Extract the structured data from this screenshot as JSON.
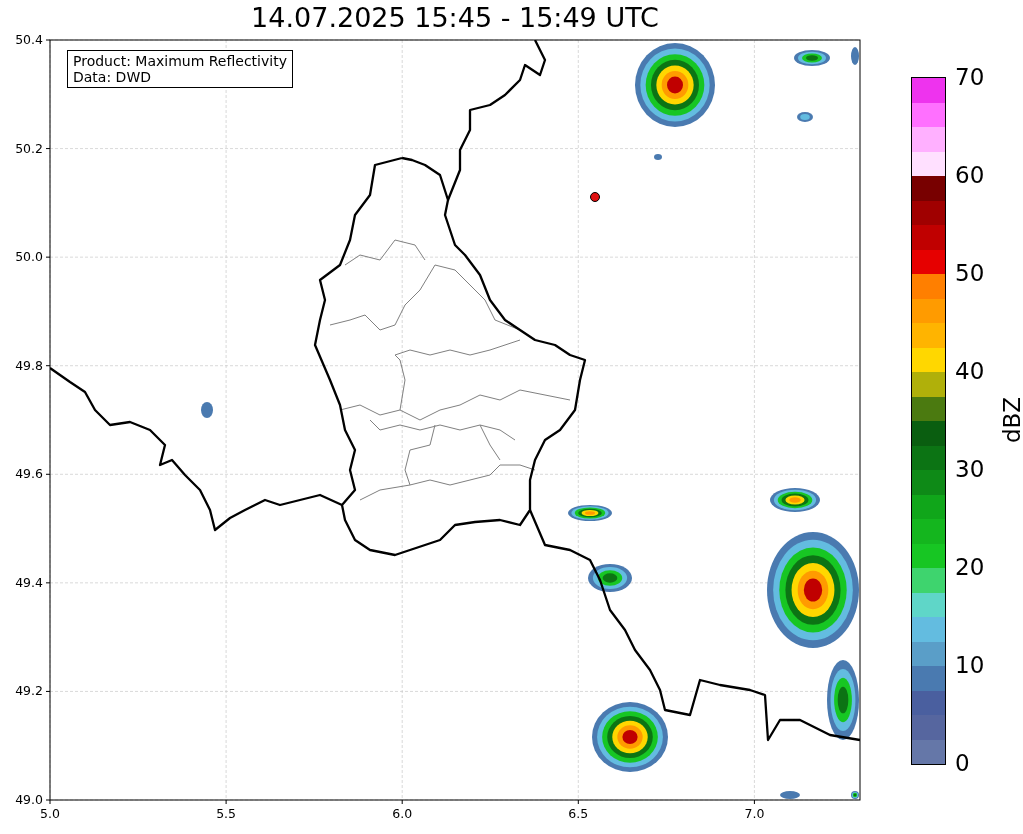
{
  "title": "14.07.2025 15:45 - 15:49 UTC",
  "map": {
    "legend": [
      "Product: Maximum Reflectivity",
      "Data: DWD"
    ],
    "x_ticks": [
      "5.0",
      "5.5",
      "6.0",
      "6.5",
      "7.0"
    ],
    "y_ticks": [
      "50.4",
      "50.2",
      "50.0",
      "49.8",
      "49.6",
      "49.4",
      "49.2",
      "49.0"
    ]
  },
  "colorbar": {
    "label": "dBZ",
    "ticks": [
      "70",
      "60",
      "50",
      "40",
      "30",
      "20",
      "10",
      "0"
    ],
    "bins": [
      {
        "color": "#6577a8"
      },
      {
        "color": "#56669f"
      },
      {
        "color": "#4a5f9f"
      },
      {
        "color": "#4a7ab0"
      },
      {
        "color": "#5a9ec8"
      },
      {
        "color": "#63bce0"
      },
      {
        "color": "#5fd6c8"
      },
      {
        "color": "#3ed46e"
      },
      {
        "color": "#17c623"
      },
      {
        "color": "#14b61e"
      },
      {
        "color": "#10a61a"
      },
      {
        "color": "#0e8a17"
      },
      {
        "color": "#0c7414"
      },
      {
        "color": "#0a5e10"
      },
      {
        "color": "#4b7a10"
      },
      {
        "color": "#b0b00a"
      },
      {
        "color": "#ffd700"
      },
      {
        "color": "#ffb400"
      },
      {
        "color": "#ff9b00"
      },
      {
        "color": "#ff7f00"
      },
      {
        "color": "#e60000"
      },
      {
        "color": "#c00000"
      },
      {
        "color": "#a00000"
      },
      {
        "color": "#780000"
      },
      {
        "color": "#ffe0ff"
      },
      {
        "color": "#ffb0ff"
      },
      {
        "color": "#ff70ff"
      },
      {
        "color": "#ee33ee"
      }
    ]
  }
}
